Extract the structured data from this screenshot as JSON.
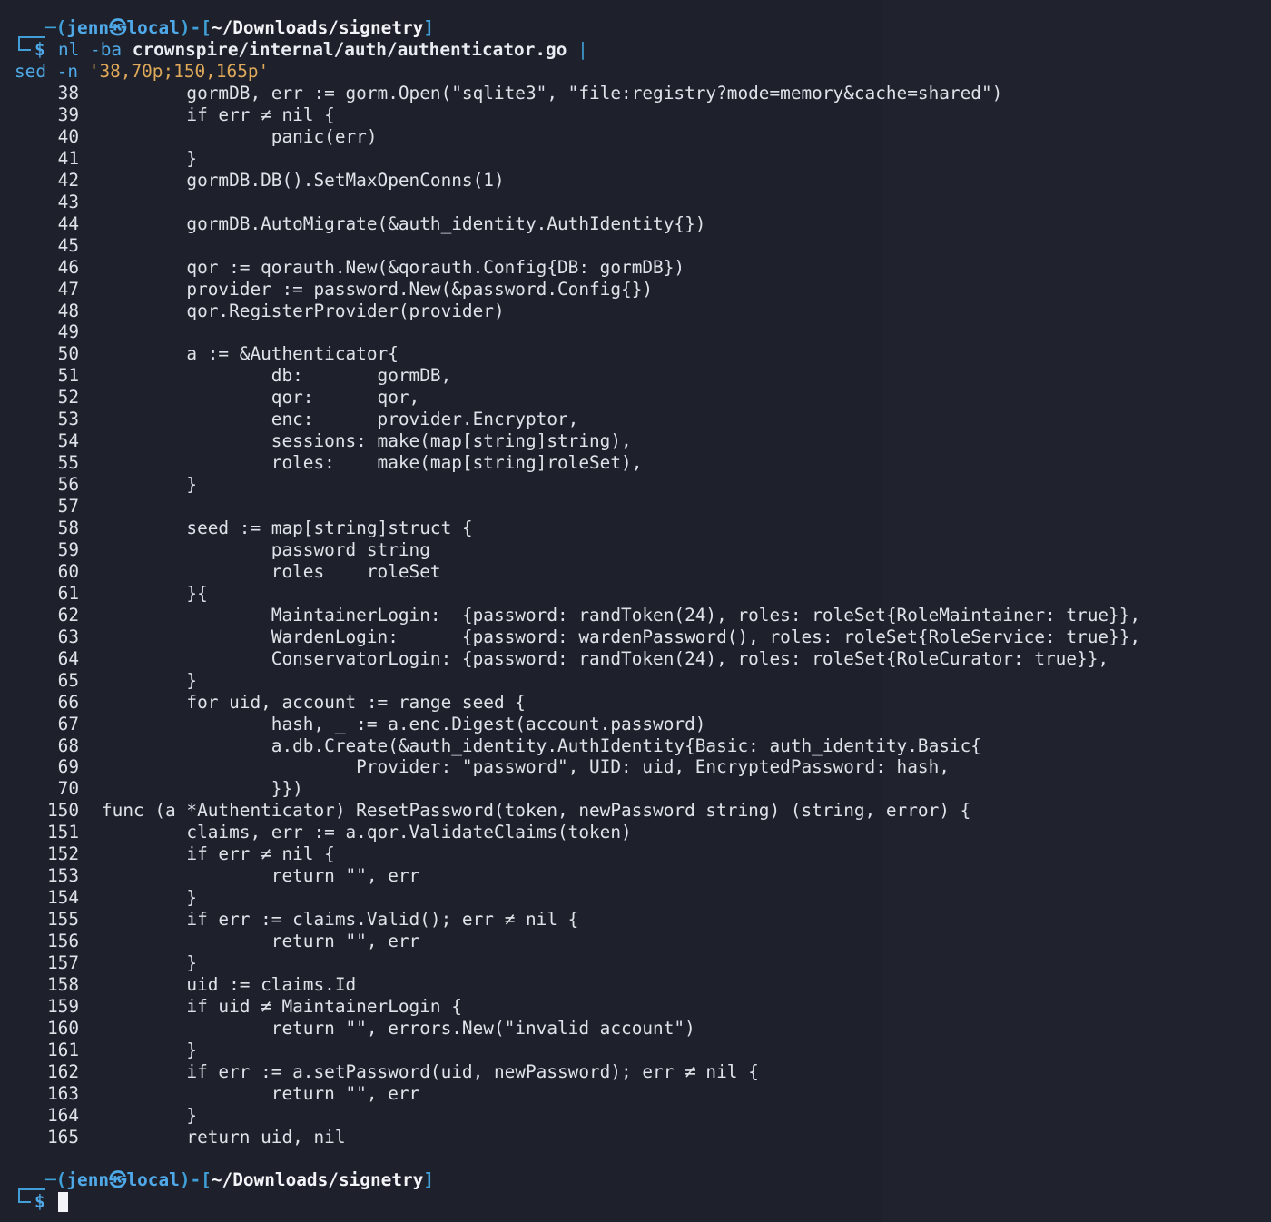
{
  "prompt": {
    "user": "jenn",
    "host": "local",
    "cwd": "~/Downloads/signetry",
    "symbol": "$",
    "skull": "㉿"
  },
  "command": {
    "program": "nl",
    "flag": "-ba",
    "path": "crownspire/internal/auth/authenticator.go",
    "pipe": "|",
    "program2": "sed",
    "flag2": "-n",
    "expr": "'38,70p;150,165p'"
  },
  "listing": [
    {
      "n": "38",
      "text": "        gormDB, err := gorm.Open(\"sqlite3\", \"file:registry?mode=memory&cache=shared\")"
    },
    {
      "n": "39",
      "text": "        if err ≠ nil {"
    },
    {
      "n": "40",
      "text": "                panic(err)"
    },
    {
      "n": "41",
      "text": "        }"
    },
    {
      "n": "42",
      "text": "        gormDB.DB().SetMaxOpenConns(1)"
    },
    {
      "n": "43",
      "text": ""
    },
    {
      "n": "44",
      "text": "        gormDB.AutoMigrate(&auth_identity.AuthIdentity{})"
    },
    {
      "n": "45",
      "text": ""
    },
    {
      "n": "46",
      "text": "        qor := qorauth.New(&qorauth.Config{DB: gormDB})"
    },
    {
      "n": "47",
      "text": "        provider := password.New(&password.Config{})"
    },
    {
      "n": "48",
      "text": "        qor.RegisterProvider(provider)"
    },
    {
      "n": "49",
      "text": ""
    },
    {
      "n": "50",
      "text": "        a := &Authenticator{"
    },
    {
      "n": "51",
      "text": "                db:       gormDB,"
    },
    {
      "n": "52",
      "text": "                qor:      qor,"
    },
    {
      "n": "53",
      "text": "                enc:      provider.Encryptor,"
    },
    {
      "n": "54",
      "text": "                sessions: make(map[string]string),"
    },
    {
      "n": "55",
      "text": "                roles:    make(map[string]roleSet),"
    },
    {
      "n": "56",
      "text": "        }"
    },
    {
      "n": "57",
      "text": ""
    },
    {
      "n": "58",
      "text": "        seed := map[string]struct {"
    },
    {
      "n": "59",
      "text": "                password string"
    },
    {
      "n": "60",
      "text": "                roles    roleSet"
    },
    {
      "n": "61",
      "text": "        }{"
    },
    {
      "n": "62",
      "text": "                MaintainerLogin:  {password: randToken(24), roles: roleSet{RoleMaintainer: true}},"
    },
    {
      "n": "63",
      "text": "                WardenLogin:      {password: wardenPassword(), roles: roleSet{RoleService: true}},"
    },
    {
      "n": "64",
      "text": "                ConservatorLogin: {password: randToken(24), roles: roleSet{RoleCurator: true}},"
    },
    {
      "n": "65",
      "text": "        }"
    },
    {
      "n": "66",
      "text": "        for uid, account := range seed {"
    },
    {
      "n": "67",
      "text": "                hash, _ := a.enc.Digest(account.password)"
    },
    {
      "n": "68",
      "text": "                a.db.Create(&auth_identity.AuthIdentity{Basic: auth_identity.Basic{"
    },
    {
      "n": "69",
      "text": "                        Provider: \"password\", UID: uid, EncryptedPassword: hash,"
    },
    {
      "n": "70",
      "text": "                }})"
    },
    {
      "n": "150",
      "text": "func (a *Authenticator) ResetPassword(token, newPassword string) (string, error) {"
    },
    {
      "n": "151",
      "text": "        claims, err := a.qor.ValidateClaims(token)"
    },
    {
      "n": "152",
      "text": "        if err ≠ nil {"
    },
    {
      "n": "153",
      "text": "                return \"\", err"
    },
    {
      "n": "154",
      "text": "        }"
    },
    {
      "n": "155",
      "text": "        if err := claims.Valid(); err ≠ nil {"
    },
    {
      "n": "156",
      "text": "                return \"\", err"
    },
    {
      "n": "157",
      "text": "        }"
    },
    {
      "n": "158",
      "text": "        uid := claims.Id"
    },
    {
      "n": "159",
      "text": "        if uid ≠ MaintainerLogin {"
    },
    {
      "n": "160",
      "text": "                return \"\", errors.New(\"invalid account\")"
    },
    {
      "n": "161",
      "text": "        }"
    },
    {
      "n": "162",
      "text": "        if err := a.setPassword(uid, newPassword); err ≠ nil {"
    },
    {
      "n": "163",
      "text": "                return \"\", err"
    },
    {
      "n": "164",
      "text": "        }"
    },
    {
      "n": "165",
      "text": "        return uid, nil"
    }
  ],
  "colors": {
    "background": "#1e212b",
    "prompt_blue": "#3f9fd6",
    "string_orange": "#e0a95a",
    "text": "#dfe2e8"
  }
}
